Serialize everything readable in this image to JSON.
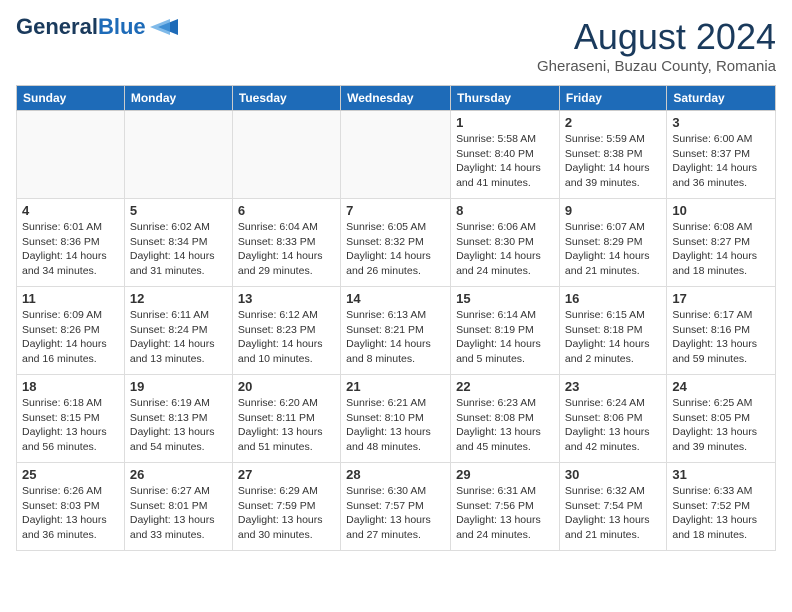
{
  "header": {
    "logo_line1": "General",
    "logo_line2": "Blue",
    "title": "August 2024",
    "location": "Gheraseni, Buzau County, Romania"
  },
  "weekdays": [
    "Sunday",
    "Monday",
    "Tuesday",
    "Wednesday",
    "Thursday",
    "Friday",
    "Saturday"
  ],
  "weeks": [
    [
      {
        "day": "",
        "info": ""
      },
      {
        "day": "",
        "info": ""
      },
      {
        "day": "",
        "info": ""
      },
      {
        "day": "",
        "info": ""
      },
      {
        "day": "1",
        "info": "Sunrise: 5:58 AM\nSunset: 8:40 PM\nDaylight: 14 hours\nand 41 minutes."
      },
      {
        "day": "2",
        "info": "Sunrise: 5:59 AM\nSunset: 8:38 PM\nDaylight: 14 hours\nand 39 minutes."
      },
      {
        "day": "3",
        "info": "Sunrise: 6:00 AM\nSunset: 8:37 PM\nDaylight: 14 hours\nand 36 minutes."
      }
    ],
    [
      {
        "day": "4",
        "info": "Sunrise: 6:01 AM\nSunset: 8:36 PM\nDaylight: 14 hours\nand 34 minutes."
      },
      {
        "day": "5",
        "info": "Sunrise: 6:02 AM\nSunset: 8:34 PM\nDaylight: 14 hours\nand 31 minutes."
      },
      {
        "day": "6",
        "info": "Sunrise: 6:04 AM\nSunset: 8:33 PM\nDaylight: 14 hours\nand 29 minutes."
      },
      {
        "day": "7",
        "info": "Sunrise: 6:05 AM\nSunset: 8:32 PM\nDaylight: 14 hours\nand 26 minutes."
      },
      {
        "day": "8",
        "info": "Sunrise: 6:06 AM\nSunset: 8:30 PM\nDaylight: 14 hours\nand 24 minutes."
      },
      {
        "day": "9",
        "info": "Sunrise: 6:07 AM\nSunset: 8:29 PM\nDaylight: 14 hours\nand 21 minutes."
      },
      {
        "day": "10",
        "info": "Sunrise: 6:08 AM\nSunset: 8:27 PM\nDaylight: 14 hours\nand 18 minutes."
      }
    ],
    [
      {
        "day": "11",
        "info": "Sunrise: 6:09 AM\nSunset: 8:26 PM\nDaylight: 14 hours\nand 16 minutes."
      },
      {
        "day": "12",
        "info": "Sunrise: 6:11 AM\nSunset: 8:24 PM\nDaylight: 14 hours\nand 13 minutes."
      },
      {
        "day": "13",
        "info": "Sunrise: 6:12 AM\nSunset: 8:23 PM\nDaylight: 14 hours\nand 10 minutes."
      },
      {
        "day": "14",
        "info": "Sunrise: 6:13 AM\nSunset: 8:21 PM\nDaylight: 14 hours\nand 8 minutes."
      },
      {
        "day": "15",
        "info": "Sunrise: 6:14 AM\nSunset: 8:19 PM\nDaylight: 14 hours\nand 5 minutes."
      },
      {
        "day": "16",
        "info": "Sunrise: 6:15 AM\nSunset: 8:18 PM\nDaylight: 14 hours\nand 2 minutes."
      },
      {
        "day": "17",
        "info": "Sunrise: 6:17 AM\nSunset: 8:16 PM\nDaylight: 13 hours\nand 59 minutes."
      }
    ],
    [
      {
        "day": "18",
        "info": "Sunrise: 6:18 AM\nSunset: 8:15 PM\nDaylight: 13 hours\nand 56 minutes."
      },
      {
        "day": "19",
        "info": "Sunrise: 6:19 AM\nSunset: 8:13 PM\nDaylight: 13 hours\nand 54 minutes."
      },
      {
        "day": "20",
        "info": "Sunrise: 6:20 AM\nSunset: 8:11 PM\nDaylight: 13 hours\nand 51 minutes."
      },
      {
        "day": "21",
        "info": "Sunrise: 6:21 AM\nSunset: 8:10 PM\nDaylight: 13 hours\nand 48 minutes."
      },
      {
        "day": "22",
        "info": "Sunrise: 6:23 AM\nSunset: 8:08 PM\nDaylight: 13 hours\nand 45 minutes."
      },
      {
        "day": "23",
        "info": "Sunrise: 6:24 AM\nSunset: 8:06 PM\nDaylight: 13 hours\nand 42 minutes."
      },
      {
        "day": "24",
        "info": "Sunrise: 6:25 AM\nSunset: 8:05 PM\nDaylight: 13 hours\nand 39 minutes."
      }
    ],
    [
      {
        "day": "25",
        "info": "Sunrise: 6:26 AM\nSunset: 8:03 PM\nDaylight: 13 hours\nand 36 minutes."
      },
      {
        "day": "26",
        "info": "Sunrise: 6:27 AM\nSunset: 8:01 PM\nDaylight: 13 hours\nand 33 minutes."
      },
      {
        "day": "27",
        "info": "Sunrise: 6:29 AM\nSunset: 7:59 PM\nDaylight: 13 hours\nand 30 minutes."
      },
      {
        "day": "28",
        "info": "Sunrise: 6:30 AM\nSunset: 7:57 PM\nDaylight: 13 hours\nand 27 minutes."
      },
      {
        "day": "29",
        "info": "Sunrise: 6:31 AM\nSunset: 7:56 PM\nDaylight: 13 hours\nand 24 minutes."
      },
      {
        "day": "30",
        "info": "Sunrise: 6:32 AM\nSunset: 7:54 PM\nDaylight: 13 hours\nand 21 minutes."
      },
      {
        "day": "31",
        "info": "Sunrise: 6:33 AM\nSunset: 7:52 PM\nDaylight: 13 hours\nand 18 minutes."
      }
    ]
  ]
}
